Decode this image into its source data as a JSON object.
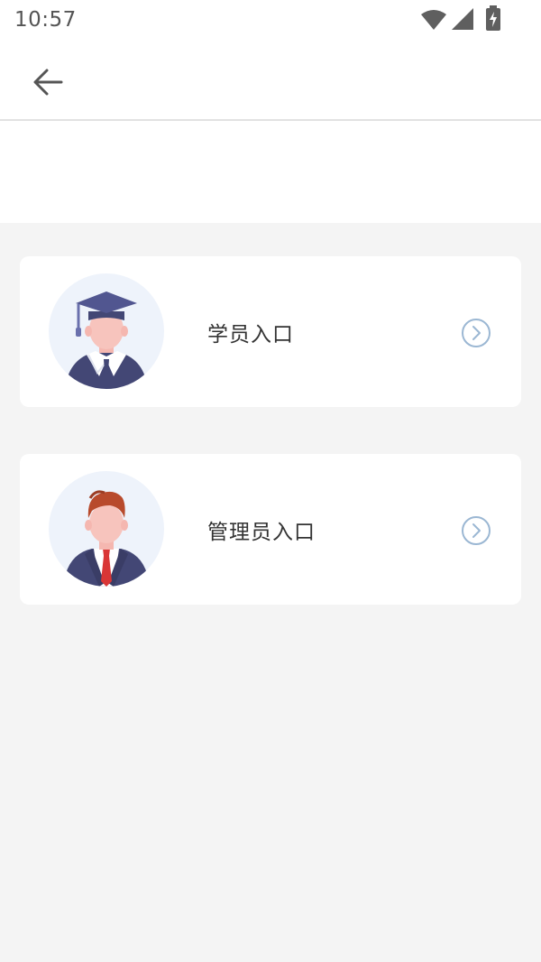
{
  "status_bar": {
    "time": "10:57",
    "icons": [
      "wifi-icon",
      "signal-icon",
      "battery-charging-icon"
    ]
  },
  "toolbar": {
    "back_icon": "arrow-left-icon"
  },
  "entries": [
    {
      "label": "学员入口",
      "avatar": "student-graduate-avatar",
      "action_icon": "chevron-right-circle-icon"
    },
    {
      "label": "管理员入口",
      "avatar": "administrator-avatar",
      "action_icon": "chevron-right-circle-icon"
    }
  ],
  "colors": {
    "background": "#f4f4f4",
    "card": "#ffffff",
    "chevron": "#9bb7d3",
    "avatar_circle": "#eef3fb",
    "gown": "#434775",
    "tie_red": "#d93636"
  }
}
